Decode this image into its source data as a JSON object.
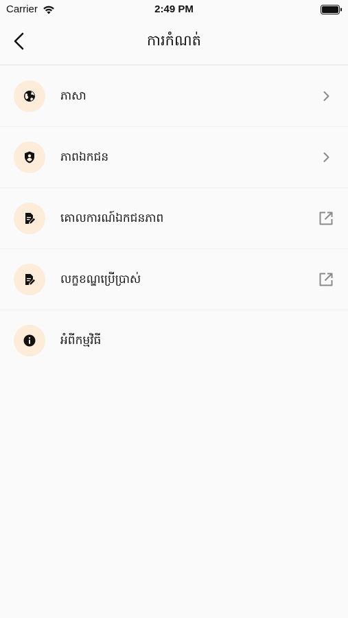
{
  "status_bar": {
    "carrier": "Carrier",
    "time": "2:49 PM",
    "icons": [
      "wifi-icon",
      "battery-icon"
    ]
  },
  "nav": {
    "title": "ការកំណត់",
    "back_icon": "chevron-left-icon"
  },
  "settings": {
    "items": [
      {
        "label": "ភាសា",
        "icon": "globe-icon",
        "trailing": "chevron-right-icon"
      },
      {
        "label": "ភាពឯកជន",
        "icon": "shield-person-icon",
        "trailing": "chevron-right-icon"
      },
      {
        "label": "គោលការណ៍ឯកជនភាព",
        "icon": "document-edit-icon",
        "trailing": "external-link-icon"
      },
      {
        "label": "លក្ខខណ្ឌប្រើប្រាស់",
        "icon": "document-edit-icon",
        "trailing": "external-link-icon"
      },
      {
        "label": "អំពីកម្មវិធី",
        "icon": "info-icon",
        "trailing": ""
      }
    ]
  },
  "colors": {
    "background": "#fafafa",
    "icon_circle": "#fcecd9",
    "trailing_icon": "#8a8a8a"
  }
}
